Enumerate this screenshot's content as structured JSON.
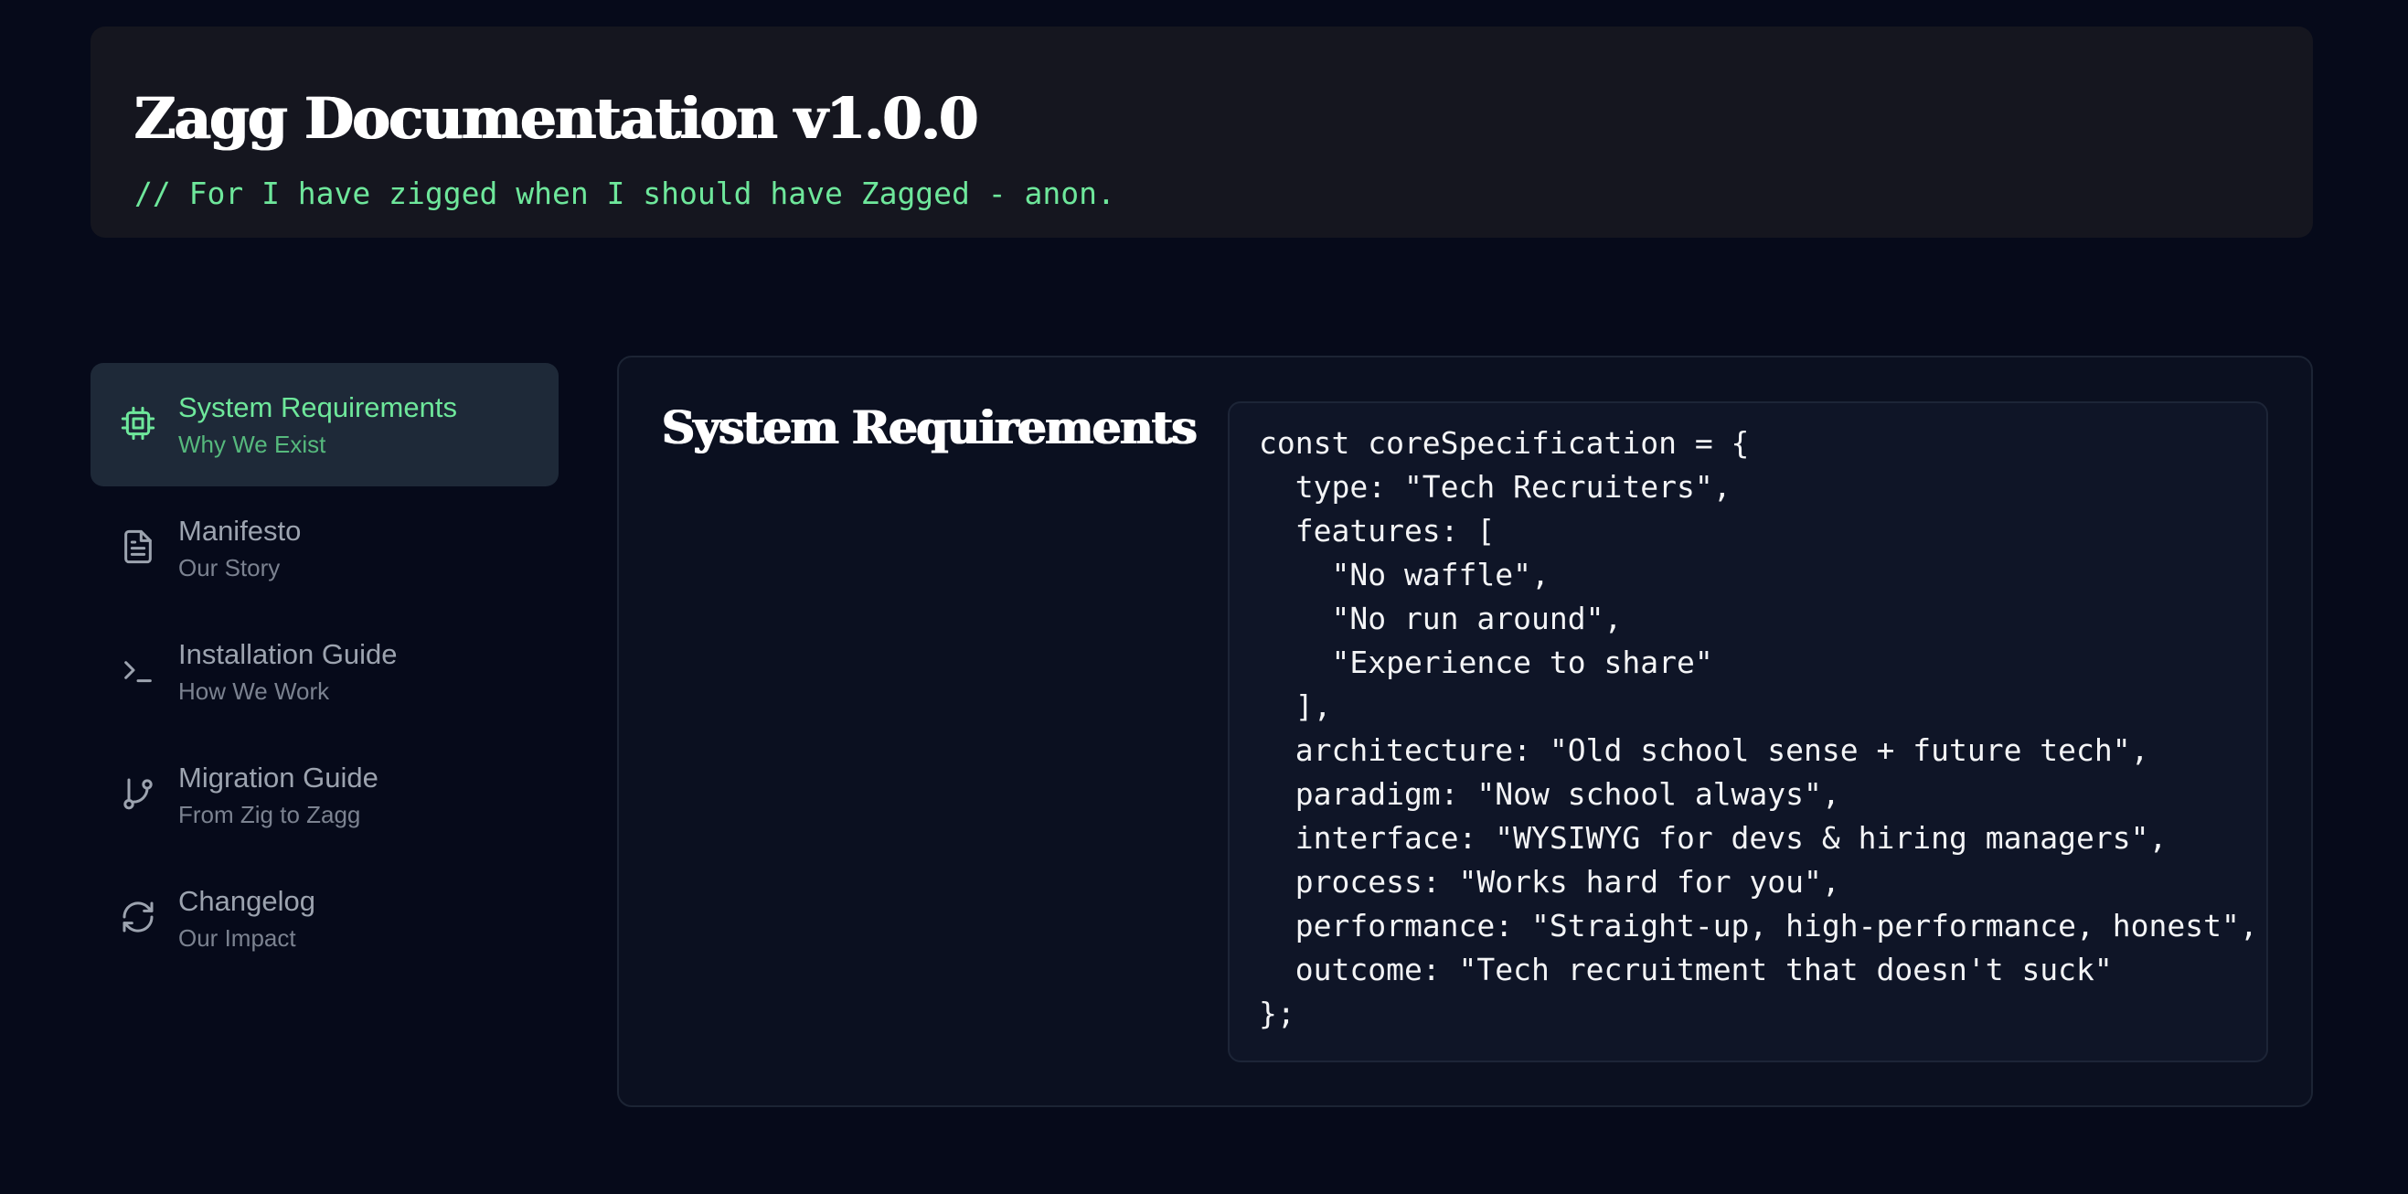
{
  "header": {
    "title": "Zagg Documentation v1.0.0",
    "subtitle": "// For I have zigged when I should have Zagged - anon."
  },
  "sidebar": {
    "items": [
      {
        "label": "System Requirements",
        "subtitle": "Why We Exist",
        "icon": "cpu-icon",
        "active": true
      },
      {
        "label": "Manifesto",
        "subtitle": "Our Story",
        "icon": "document-icon",
        "active": false
      },
      {
        "label": "Installation Guide",
        "subtitle": "How We Work",
        "icon": "terminal-icon",
        "active": false
      },
      {
        "label": "Migration Guide",
        "subtitle": "From Zig to Zagg",
        "icon": "git-branch-icon",
        "active": false
      },
      {
        "label": "Changelog",
        "subtitle": "Our Impact",
        "icon": "refresh-icon",
        "active": false
      }
    ]
  },
  "main": {
    "title": "System Requirements",
    "code_lines": [
      "const coreSpecification = {",
      "  type: \"Tech Recruiters\",",
      "  features: [",
      "    \"No waffle\",",
      "    \"No run around\",",
      "    \"Experience to share\"",
      "  ],",
      "  architecture: \"Old school sense + future tech\",",
      "  paradigm: \"Now school always\",",
      "  interface: \"WYSIWYG for devs & hiring managers\",",
      "  process: \"Works hard for you\",",
      "  performance: \"Straight-up, high-performance, honest\",",
      "  outcome: \"Tech recruitment that doesn't suck\"",
      "};"
    ]
  },
  "colors": {
    "background": "#060a1a",
    "accent": "#6ee79b",
    "panel": "#0b1020",
    "active_item": "#1e2938"
  }
}
